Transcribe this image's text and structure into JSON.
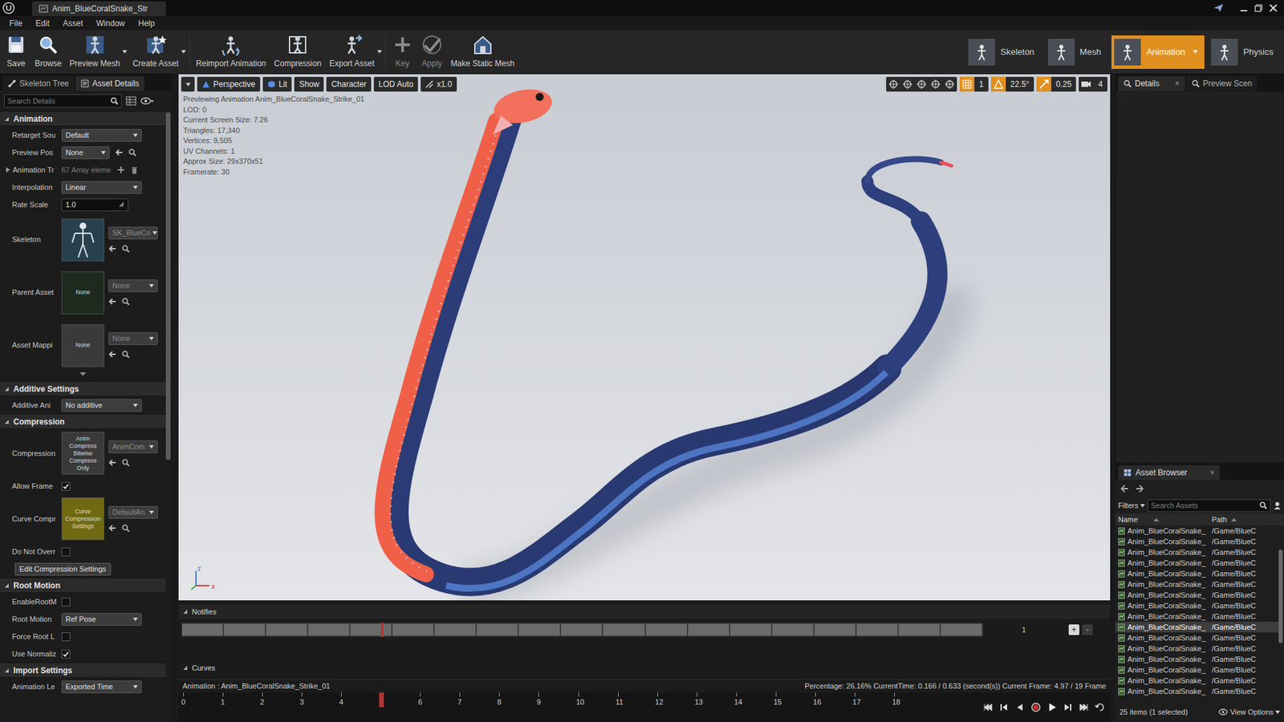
{
  "window": {
    "title": "Anim_BlueCoralSnake_Str"
  },
  "menu": [
    "File",
    "Edit",
    "Asset",
    "Window",
    "Help"
  ],
  "toolbar": [
    {
      "label": "Save",
      "disabled": false,
      "dropdown": false
    },
    {
      "label": "Browse",
      "disabled": false,
      "dropdown": false
    },
    {
      "label": "Preview Mesh",
      "disabled": false,
      "dropdown": true
    },
    {
      "label": "Create Asset",
      "disabled": false,
      "dropdown": true
    },
    {
      "label": "Reimport Animation",
      "disabled": false,
      "dropdown": false
    },
    {
      "label": "Compression",
      "disabled": false,
      "dropdown": false
    },
    {
      "label": "Export Asset",
      "disabled": false,
      "dropdown": true
    },
    {
      "label": "Key",
      "disabled": true,
      "dropdown": false
    },
    {
      "label": "Apply",
      "disabled": true,
      "dropdown": false
    },
    {
      "label": "Make Static Mesh",
      "disabled": false,
      "dropdown": false
    }
  ],
  "modes": [
    {
      "label": "Skeleton",
      "selected": false
    },
    {
      "label": "Mesh",
      "selected": false
    },
    {
      "label": "Animation",
      "selected": true
    },
    {
      "label": "Physics",
      "selected": false
    }
  ],
  "left_panel": {
    "tabs": [
      {
        "label": "Skeleton Tree",
        "selected": false
      },
      {
        "label": "Asset Details",
        "selected": true
      }
    ],
    "search": {
      "placeholder": "Search Details"
    },
    "sections": [
      {
        "title": "Animation",
        "expanded": true,
        "rows": [
          {
            "kind": "dropdown",
            "label": "Retarget Sou",
            "value": "Default",
            "tools": false
          },
          {
            "kind": "dropdown",
            "label": "Preview Pos",
            "value": "None",
            "tools": true
          },
          {
            "kind": "array",
            "label": "Animation Tr",
            "value": "67 Array eleme",
            "expanded": false
          },
          {
            "kind": "dropdown",
            "label": "Interpolation",
            "value": "Linear",
            "tools": false
          },
          {
            "kind": "number",
            "label": "Rate Scale",
            "value": "1.0"
          },
          {
            "kind": "asset",
            "label": "Skeleton",
            "value": "SK_BlueCo",
            "thumb_color": "#28414f"
          },
          {
            "kind": "asset",
            "label": "Parent Asset",
            "thumb": "None",
            "value": "None",
            "thumb_color": "#1d2b1f"
          },
          {
            "kind": "asset",
            "label": "Asset Mappi",
            "thumb": "None",
            "value": "None",
            "thumb_color": "#3a3a3a"
          }
        ]
      },
      {
        "title": "Additive Settings",
        "expanded": true,
        "rows": [
          {
            "kind": "dropdown",
            "label": "Additive Ani",
            "value": "No additive",
            "tools": false
          }
        ]
      },
      {
        "title": "Compression",
        "expanded": true,
        "rows": [
          {
            "kind": "asset",
            "label": "Compression",
            "thumb": "Anim Compress Bitwise Compress Only",
            "value": "AnimCom",
            "thumb_color": "#3a3a3a"
          },
          {
            "kind": "checkbox",
            "label": "Allow Frame",
            "checked": true
          },
          {
            "kind": "asset",
            "label": "Curve Compr",
            "thumb": "Curve Compression Settings",
            "value": "DefaultAn",
            "thumb_color": "#6f6a12"
          },
          {
            "kind": "checkbox",
            "label": "Do Not Overr",
            "checked": false
          },
          {
            "kind": "button",
            "label": "Edit Compression Settings"
          }
        ]
      },
      {
        "title": "Root Motion",
        "expanded": true,
        "rows": [
          {
            "kind": "checkbox",
            "label": "EnableRootM",
            "checked": false
          },
          {
            "kind": "dropdown",
            "label": "Root Motion",
            "value": "Ref Pose",
            "tools": false
          },
          {
            "kind": "checkbox",
            "label": "Force Root L",
            "checked": false
          },
          {
            "kind": "checkbox",
            "label": "Use Normaliz",
            "checked": true
          }
        ]
      },
      {
        "title": "Import Settings",
        "expanded": true,
        "rows": [
          {
            "kind": "dropdown",
            "label": "Animation Le",
            "value": "Exported Time",
            "tools": false
          }
        ]
      }
    ]
  },
  "viewport": {
    "toolbar": [
      "Perspective",
      "Lit",
      "Show",
      "Character",
      "LOD Auto",
      "x1.0"
    ],
    "snap": [
      {
        "value": "1",
        "enabled": true
      },
      {
        "value": "22.5°",
        "enabled": true
      },
      {
        "value": "0.25",
        "enabled": true
      },
      {
        "value": "4",
        "enabled": false
      }
    ],
    "stats": [
      "Previewing Animation Anim_BlueCoralSnake_Strike_01",
      "LOD: 0",
      "Current Screen Size: 7.26",
      "Triangles: 17,340",
      "Vertices: 9,505",
      "UV Channels: 1",
      "Approx Size: 29x370x51",
      "Framerate: 30"
    ],
    "axes": [
      {
        "label": "z",
        "color": "#4a7bd6"
      },
      {
        "label": "x",
        "color": "#d43a3a"
      }
    ]
  },
  "timeline": {
    "notifies_label": "Notifies",
    "track_count": "1",
    "add": "+",
    "remove": "-",
    "curves_label": "Curves",
    "animation": "Animation : Anim_BlueCoralSnake_Strike_01",
    "status": "Percentage: 26.16% CurrentTime: 0.166 / 0.633 (second(s)) Current Frame: 4.97 / 19 Frame",
    "ticks": [
      "0",
      "1",
      "2",
      "3",
      "4",
      "5",
      "6",
      "7",
      "8",
      "9",
      "10",
      "11",
      "12",
      "13",
      "14",
      "15",
      "16",
      "17",
      "18"
    ],
    "level": 0.2616
  },
  "right_panel": {
    "tabs": [
      {
        "label": "Details",
        "selected": true,
        "close": "×"
      },
      {
        "label": "Preview Scen",
        "selected": false
      }
    ],
    "asset_browser": {
      "title": "Asset Browser",
      "close": "×",
      "filters": "Filters",
      "search": {
        "placeholder": "Search Assets"
      },
      "columns": [
        "Name",
        "Path"
      ],
      "rows": [
        {
          "name": "Anim_BlueCoralSnake_",
          "path": "/Game/BlueC",
          "selected": false
        },
        {
          "name": "Anim_BlueCoralSnake_",
          "path": "/Game/BlueC",
          "selected": false
        },
        {
          "name": "Anim_BlueCoralSnake_",
          "path": "/Game/BlueC",
          "selected": false
        },
        {
          "name": "Anim_BlueCoralSnake_",
          "path": "/Game/BlueC",
          "selected": false
        },
        {
          "name": "Anim_BlueCoralSnake_",
          "path": "/Game/BlueC",
          "selected": false
        },
        {
          "name": "Anim_BlueCoralSnake_",
          "path": "/Game/BlueC",
          "selected": false
        },
        {
          "name": "Anim_BlueCoralSnake_",
          "path": "/Game/BlueC",
          "selected": false
        },
        {
          "name": "Anim_BlueCoralSnake_",
          "path": "/Game/BlueC",
          "selected": false
        },
        {
          "name": "Anim_BlueCoralSnake_",
          "path": "/Game/BlueC",
          "selected": false
        },
        {
          "name": "Anim_BlueCoralSnake_",
          "path": "/Game/BlueC",
          "selected": true
        },
        {
          "name": "Anim_BlueCoralSnake_",
          "path": "/Game/BlueC",
          "selected": false
        },
        {
          "name": "Anim_BlueCoralSnake_",
          "path": "/Game/BlueC",
          "selected": false
        },
        {
          "name": "Anim_BlueCoralSnake_",
          "path": "/Game/BlueC",
          "selected": false
        },
        {
          "name": "Anim_BlueCoralSnake_",
          "path": "/Game/BlueC",
          "selected": false
        },
        {
          "name": "Anim_BlueCoralSnake_",
          "path": "/Game/BlueC",
          "selected": false
        },
        {
          "name": "Anim_BlueCoralSnake_",
          "path": "/Game/BlueC",
          "selected": false
        }
      ],
      "count": "25 items (1 selected)",
      "view_options": "View Options"
    }
  }
}
